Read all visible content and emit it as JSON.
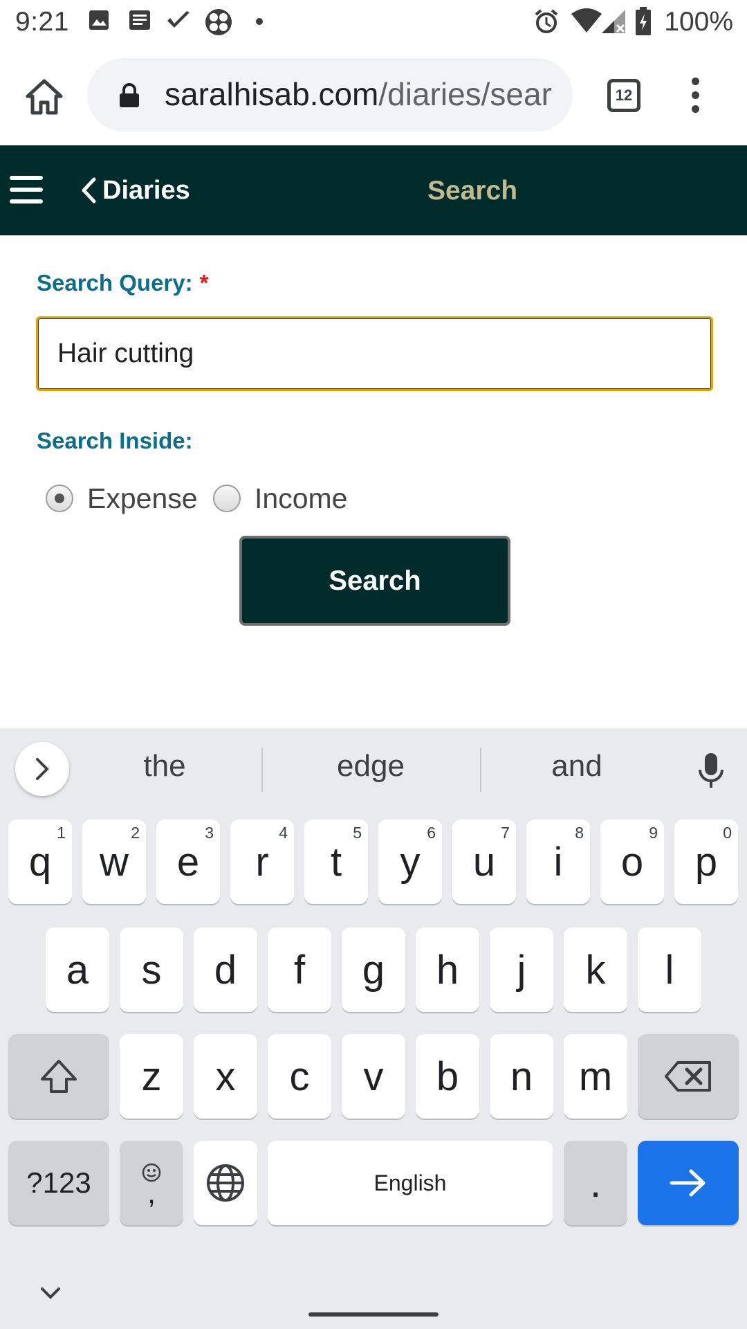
{
  "status_bar": {
    "time": "9:21",
    "battery": "100%",
    "icons_left": [
      "photo-icon",
      "news-icon",
      "check-icon",
      "fan-icon",
      "dot-icon"
    ],
    "icons_right": [
      "alarm-icon",
      "wifi-icon",
      "signal-icon",
      "battery-icon"
    ]
  },
  "browser": {
    "url_host": "saralhisab.com",
    "url_path": "/diaries/search",
    "tab_count": "12"
  },
  "navbar": {
    "back_label": "Diaries",
    "title": "Search",
    "title_color": "#c2b98e",
    "bg_color": "#002b2b"
  },
  "form": {
    "query_label": "Search Query:",
    "required_mark": "*",
    "query_value": "Hair cutting",
    "inside_label": "Search Inside:",
    "options": [
      {
        "label": "Expense",
        "checked": true
      },
      {
        "label": "Income",
        "checked": false
      }
    ],
    "submit_label": "Search"
  },
  "keyboard": {
    "suggestions": [
      "the",
      "edge",
      "and"
    ],
    "row1": [
      {
        "key": "q",
        "hint": "1"
      },
      {
        "key": "w",
        "hint": "2"
      },
      {
        "key": "e",
        "hint": "3"
      },
      {
        "key": "r",
        "hint": "4"
      },
      {
        "key": "t",
        "hint": "5"
      },
      {
        "key": "y",
        "hint": "6"
      },
      {
        "key": "u",
        "hint": "7"
      },
      {
        "key": "i",
        "hint": "8"
      },
      {
        "key": "o",
        "hint": "9"
      },
      {
        "key": "p",
        "hint": "0"
      }
    ],
    "row2": [
      "a",
      "s",
      "d",
      "f",
      "g",
      "h",
      "j",
      "k",
      "l"
    ],
    "row3": [
      "z",
      "x",
      "c",
      "v",
      "b",
      "n",
      "m"
    ],
    "symbols_label": "?123",
    "comma_label": ",",
    "space_label": "English",
    "period_label": "."
  }
}
